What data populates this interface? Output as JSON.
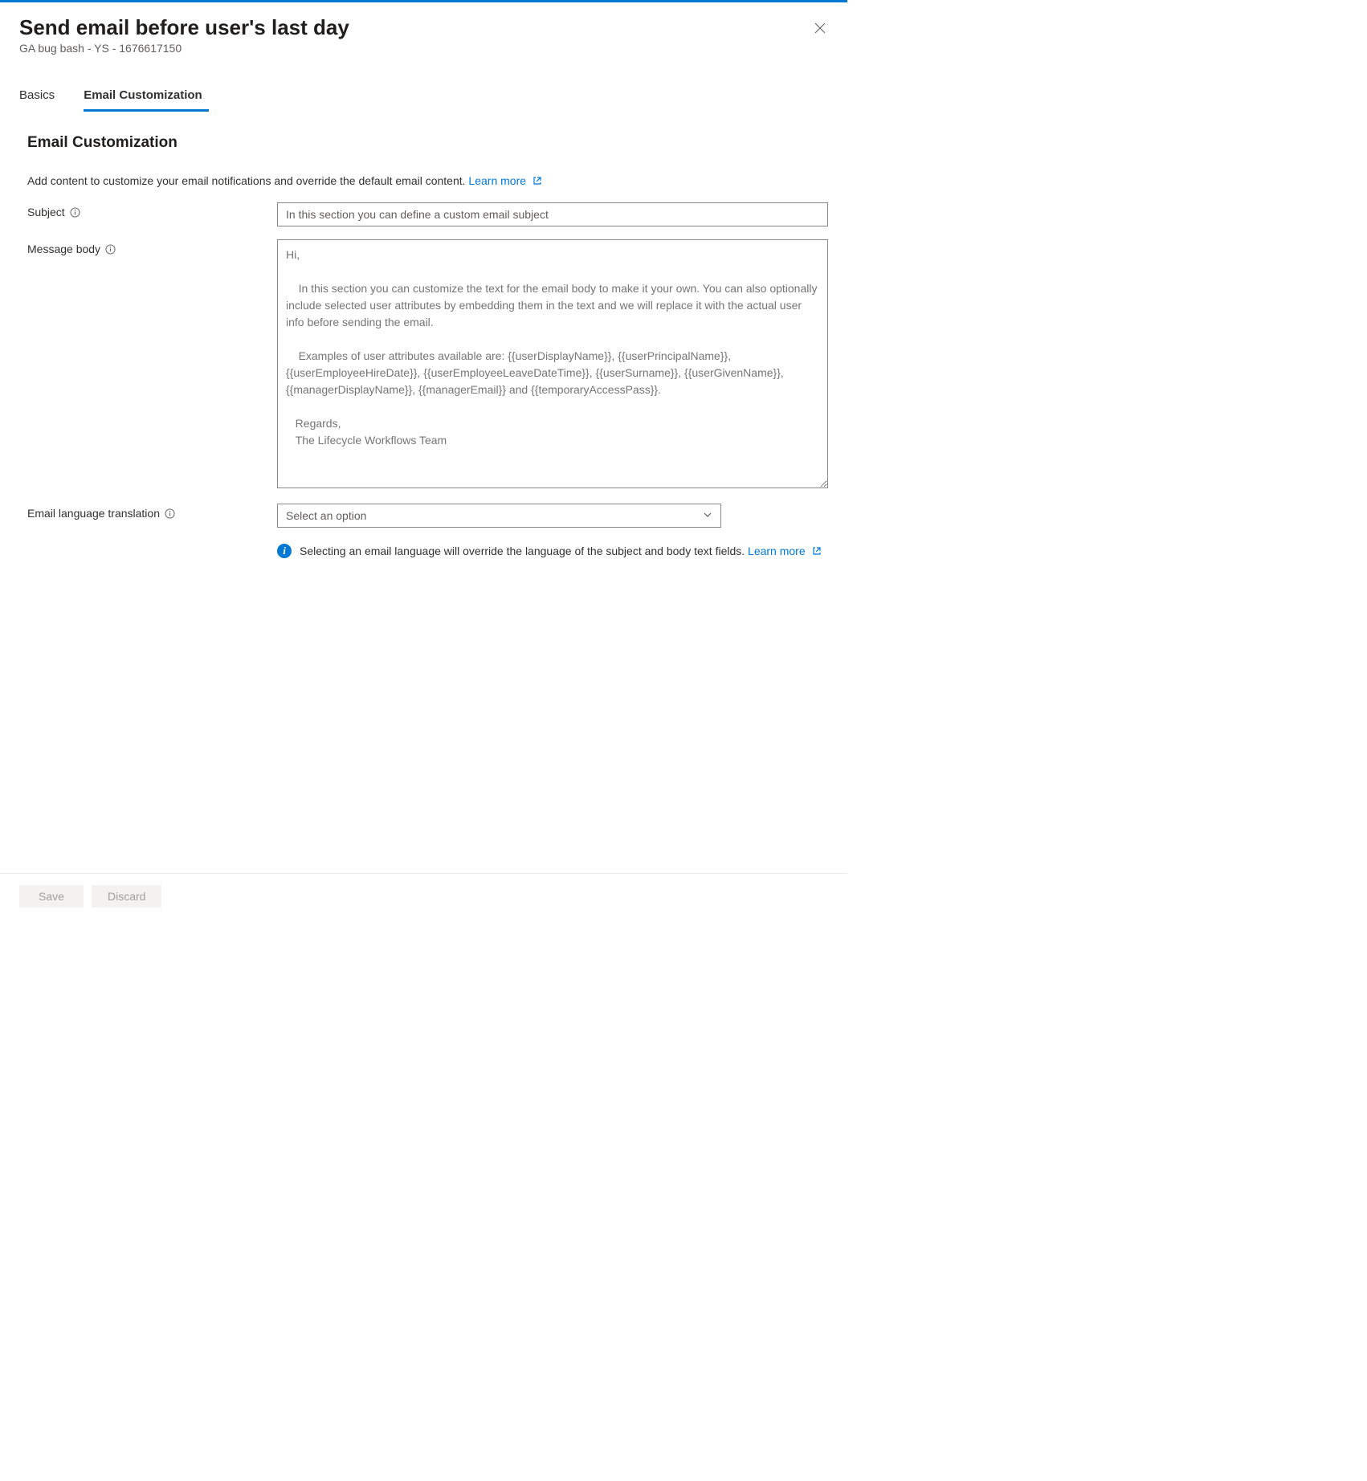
{
  "header": {
    "title": "Send email before user's last day",
    "subtitle": "GA bug bash - YS - 1676617150"
  },
  "tabs": [
    {
      "label": "Basics",
      "active": false
    },
    {
      "label": "Email Customization",
      "active": true
    }
  ],
  "section": {
    "title": "Email Customization",
    "description": "Add content to customize your email notifications and override the default email content.",
    "learn_more": "Learn more"
  },
  "form": {
    "subject": {
      "label": "Subject",
      "placeholder": "In this section you can define a custom email subject",
      "value": ""
    },
    "message_body": {
      "label": "Message body",
      "placeholder": "Hi,\n\n    In this section you can customize the text for the email body to make it your own. You can also optionally include selected user attributes by embedding them in the text and we will replace it with the actual user info before sending the email.\n\n    Examples of user attributes available are: {{userDisplayName}}, {{userPrincipalName}}, {{userEmployeeHireDate}}, {{userEmployeeLeaveDateTime}}, {{userSurname}}, {{userGivenName}}, {{managerDisplayName}}, {{managerEmail}} and {{temporaryAccessPass}}.\n\n   Regards,\n   The Lifecycle Workflows Team",
      "value": ""
    },
    "language": {
      "label": "Email language translation",
      "placeholder": "Select an option",
      "info_message": "Selecting an email language will override the language of the subject and body text fields.",
      "learn_more": "Learn more"
    }
  },
  "footer": {
    "save": "Save",
    "discard": "Discard"
  }
}
